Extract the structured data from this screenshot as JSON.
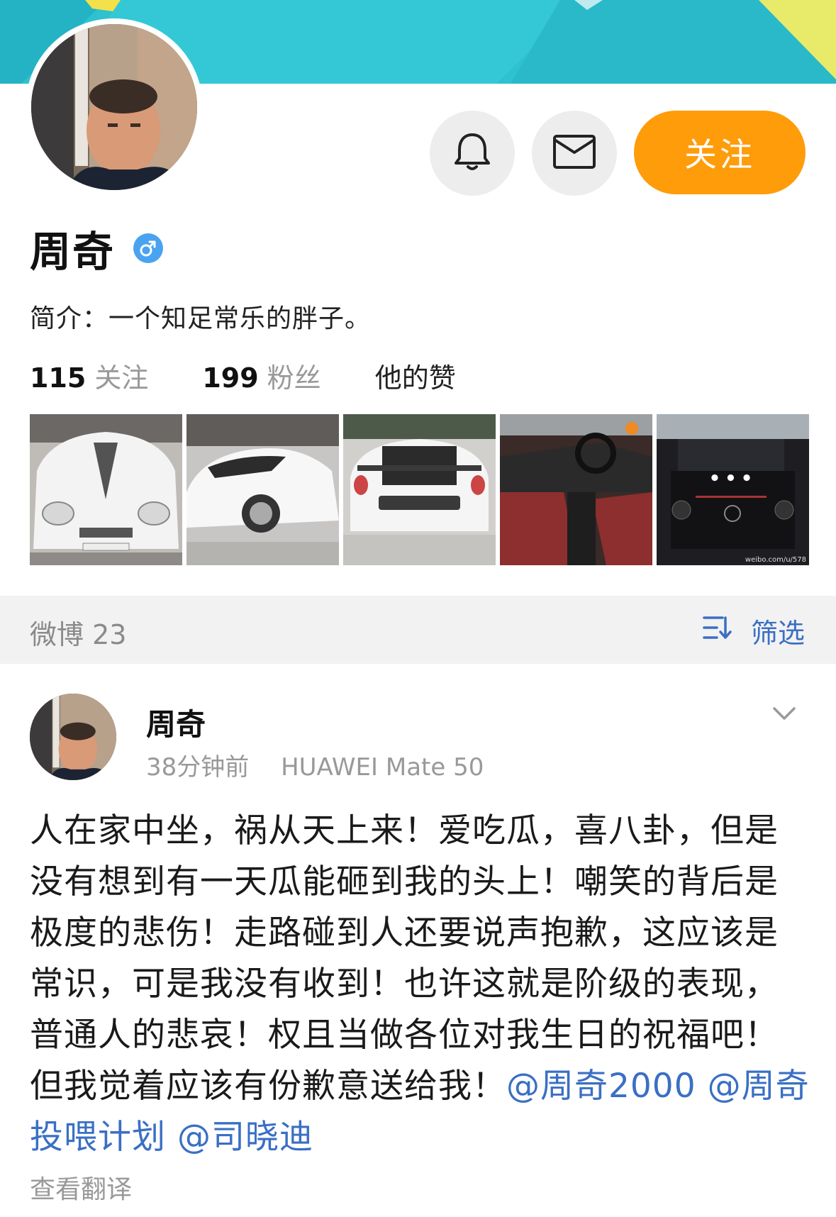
{
  "profile": {
    "name": "周奇",
    "bio": "简介：一个知足常乐的胖子。",
    "follow_label": "关注"
  },
  "stats": {
    "following_count": "115",
    "following_label": "关注",
    "followers_count": "199",
    "followers_label": "粉丝",
    "likes_label": "他的赞"
  },
  "photos": {
    "items": [
      "white-supercar-front",
      "white-sports-car-side",
      "white-car-rear",
      "red-car-interior",
      "black-suv-front"
    ],
    "more_label": "•••",
    "watermark": "weibo.com/u/578"
  },
  "section": {
    "weibo_count_label": "微博 23",
    "filter_label": "筛选"
  },
  "post": {
    "author": "周奇",
    "time": "38分钟前",
    "device": "HUAWEI Mate 50",
    "text": "人在家中坐，祸从天上来！爱吃瓜，喜八卦，但是没有想到有一天瓜能砸到我的头上！嘲笑的背后是极度的悲伤！走路碰到人还要说声抱歉，这应该是常识，可是我没有收到！也许这就是阶级的表现，普通人的悲哀！权且当做各位对我生日的祝福吧！但我觉着应该有份歉意送给我！",
    "mentions": [
      "@周奇2000",
      "@周奇投喂计划",
      "@司晓迪"
    ],
    "translate_label": "查看翻译"
  },
  "colors": {
    "banner": "#2ec2d0",
    "accent_orange": "#ff9c0a",
    "link_blue": "#3a6fc4",
    "gender_badge": "#4aa3f0",
    "section_bg": "#f2f2f2"
  },
  "icons": [
    "bell-icon",
    "mail-icon",
    "gender-male-icon",
    "filter-icon",
    "chevron-down-icon"
  ]
}
